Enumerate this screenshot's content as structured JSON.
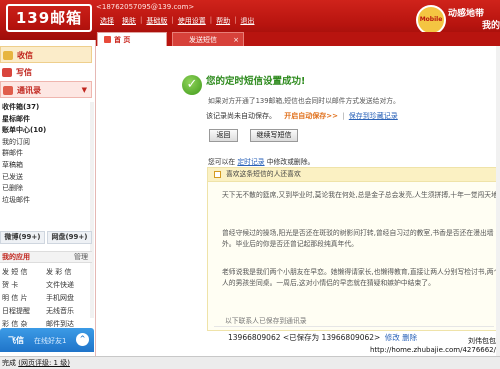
{
  "header": {
    "logo": "139邮箱",
    "account": "<18762057095@139.com>",
    "nav": [
      "选择",
      "换肤",
      "基础版",
      "使用设置",
      "帮助",
      "退出"
    ],
    "mascot_text": "Mobile",
    "slogan_line1": "动感地带",
    "slogan_line2": "我的"
  },
  "tabs": {
    "home": "首 页",
    "sms": "发送短信",
    "close": "×"
  },
  "sidebar": {
    "inbox": "收信",
    "write": "写信",
    "contacts": "通讯录",
    "contacts_arrow": "▼",
    "folders": [
      {
        "label": "收件箱(37)",
        "bold": true
      },
      {
        "label": "星标邮件",
        "bold": true
      },
      {
        "label": "账单中心(10)",
        "bold": true
      },
      {
        "label": "我的订阅",
        "bold": false
      },
      {
        "label": "群邮件",
        "bold": false
      },
      {
        "label": "草稿箱",
        "bold": false
      },
      {
        "label": "已发送",
        "bold": false
      },
      {
        "label": "已删除",
        "bold": false
      },
      {
        "label": "垃圾邮件",
        "bold": false
      }
    ],
    "pill_left": "微博(99+)",
    "pill_right": "网盘(99+)",
    "myapps_title": "我的应用",
    "myapps_manage": "管理",
    "apps": [
      "发 短 信",
      "发 彩 信",
      "贺   卡",
      "文件快递",
      "明 信 片",
      "手机网盘",
      "日程提醒",
      "无线音乐",
      "彩 信 杂",
      "邮件到达"
    ],
    "feixin_name": "飞信",
    "feixin_status": "在线好友1",
    "feixin_up": "^"
  },
  "main": {
    "success_title": "您的定时短信设置成功!",
    "description": "如果对方开通了139邮箱,短信也会同时以邮件方式发送给对方。",
    "auto_save_label": "该记录尚未自动保存。",
    "auto_save_on": "开启自动保存>>",
    "auto_save_link": "保存到珍藏记录",
    "back_button": "返回",
    "continue_button": "继续写短信",
    "hint_prefix": "您可以在",
    "hint_link": "定时记录",
    "hint_suffix": "中修改或删除。",
    "panel_header": "喜欢这条短信的人还喜欢",
    "panel_paragraphs": [
      "天下无不散的筵席,又到毕业时,莫论我在何处,总是金子总会发亮,人生须拼搏,十年一觉闯天地!",
      "曾经守候过的操场,阳光是否还在斑驳的树影间打转,曾经自习过的教室,书香是否还在漫出墙外。毕业后的你是否还曾记起那段纯真年代。",
      "老师说我是我们两个小朋友在早恋。她懒得请家长,也懒得教育,直接让两人分别写检讨书,两个人的男孩坐同桌。一周后,这对小情侣的早恋就在猜疑和嫉妒中结束了。"
    ],
    "recent_label": "以下联系人已保存到通讯录",
    "recent_number": "13966809062",
    "recent_saved": "<已保存为 13966809062>",
    "recent_edit": "修改",
    "recent_delete": "删除"
  },
  "statusbar": {
    "done": "完成",
    "rating": "(网页评级: 1 级)"
  },
  "watermark": {
    "line1": "刘伟包包",
    "line2": "http://home.zhubajie.com/4276662/"
  }
}
